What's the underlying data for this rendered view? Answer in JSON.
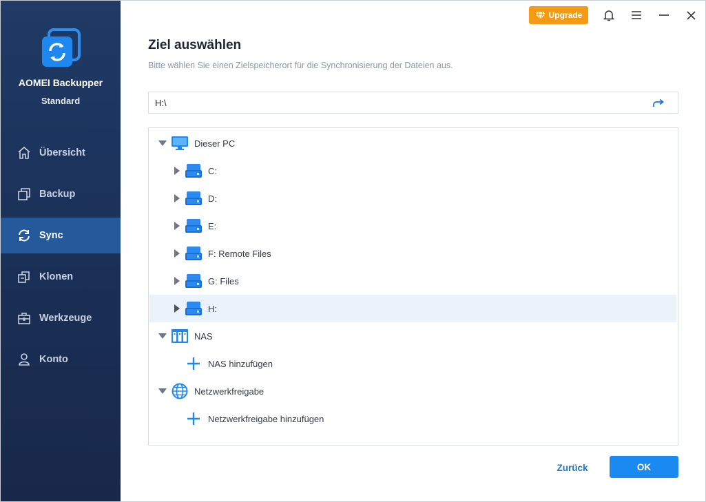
{
  "app": {
    "name": "AOMEI Backupper",
    "edition": "Standard"
  },
  "titlebar": {
    "upgrade_label": "Upgrade"
  },
  "sidebar": {
    "items": [
      {
        "label": "Übersicht",
        "icon": "home-icon",
        "active": false
      },
      {
        "label": "Backup",
        "icon": "backup-icon",
        "active": false
      },
      {
        "label": "Sync",
        "icon": "sync-icon",
        "active": true
      },
      {
        "label": "Klonen",
        "icon": "clone-icon",
        "active": false
      },
      {
        "label": "Werkzeuge",
        "icon": "toolbox-icon",
        "active": false
      },
      {
        "label": "Konto",
        "icon": "user-icon",
        "active": false
      }
    ]
  },
  "main": {
    "title": "Ziel auswählen",
    "subtitle": "Bitte wählen Sie einen Zielspeicherort für die Synchronisierung der Dateien aus.",
    "path_value": "H:\\",
    "tree": {
      "this_pc": {
        "label": "Dieser PC",
        "expanded": true
      },
      "drives": [
        {
          "label": "C:"
        },
        {
          "label": "D:"
        },
        {
          "label": "E:"
        },
        {
          "label": "F: Remote Files"
        },
        {
          "label": "G: Files"
        },
        {
          "label": "H:",
          "selected": true
        }
      ],
      "nas": {
        "label": "NAS",
        "expanded": true,
        "add_label": "NAS hinzufügen"
      },
      "network": {
        "label": "Netzwerkfreigabe",
        "expanded": true,
        "add_label": "Netzwerkfreigabe hinzufügen"
      }
    }
  },
  "footer": {
    "back_label": "Zurück",
    "ok_label": "OK"
  },
  "colors": {
    "accent": "#1b8af0",
    "sidebar": "#1f3b66",
    "active_nav": "#245a9c",
    "upgrade": "#f59a14",
    "selected_row": "#eaf2fc"
  }
}
